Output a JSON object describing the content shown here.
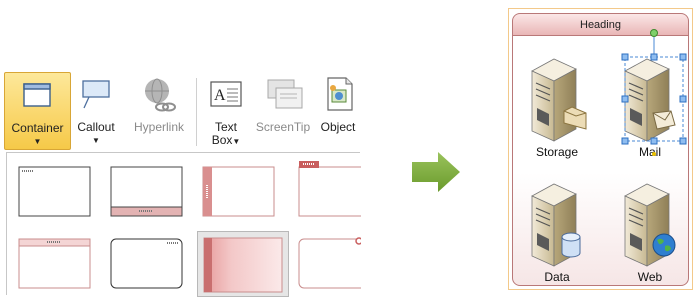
{
  "ribbon": {
    "buttons": [
      {
        "label": "Container",
        "icon": "container-icon",
        "state": "pressed",
        "has_dropdown": true
      },
      {
        "label": "Callout",
        "icon": "callout-icon",
        "has_dropdown": true
      },
      {
        "label": "Hyperlink",
        "icon": "hyperlink-icon",
        "state": "disabled"
      },
      {
        "label": "Text",
        "label2": "Box",
        "icon": "text-box-icon",
        "has_dropdown": true
      },
      {
        "label": "ScreenTip",
        "icon": "screentip-icon",
        "state": "disabled"
      },
      {
        "label": "Object",
        "icon": "object-icon"
      }
    ]
  },
  "gallery": {
    "selected_index": 6,
    "items": 8
  },
  "diagram": {
    "heading": "Heading",
    "servers": [
      {
        "label": "Storage",
        "overlay": "folder-icon"
      },
      {
        "label": "Mail",
        "overlay": "envelope-icon",
        "selected": true
      },
      {
        "label": "Data",
        "overlay": "database-icon"
      },
      {
        "label": "Web",
        "overlay": "globe-icon"
      }
    ]
  },
  "colors": {
    "container_pressed": "#f6c948",
    "container_border": "#b97878",
    "arrow": "#7fa83e",
    "selection_handle": "#4a8ad6"
  }
}
